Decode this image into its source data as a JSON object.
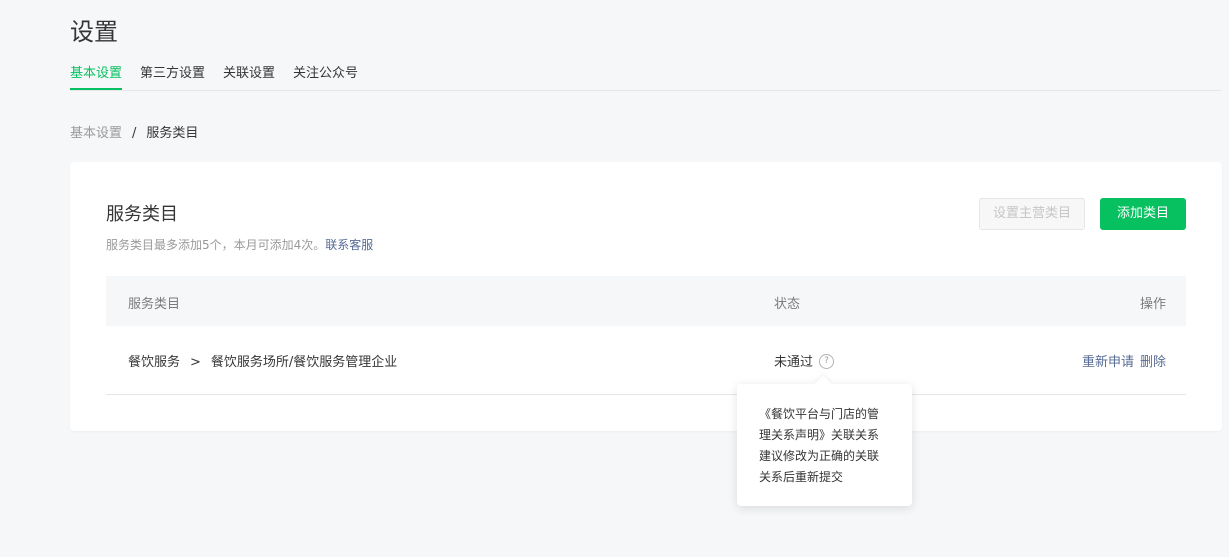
{
  "page": {
    "title": "设置"
  },
  "tabs": [
    {
      "label": "基本设置",
      "active": true
    },
    {
      "label": "第三方设置",
      "active": false
    },
    {
      "label": "关联设置",
      "active": false
    },
    {
      "label": "关注公众号",
      "active": false
    }
  ],
  "breadcrumb": {
    "parent": "基本设置",
    "separator": "/",
    "current": "服务类目"
  },
  "card": {
    "title": "服务类目",
    "desc": "服务类目最多添加5个，本月可添加4次。",
    "desc_link": "联系客服",
    "set_main_button": "设置主营类目",
    "add_button": "添加类目"
  },
  "table": {
    "headers": {
      "category": "服务类目",
      "status": "状态",
      "actions": "操作"
    },
    "rows": [
      {
        "primary": "餐饮服务",
        "arrow": ">",
        "secondary": "餐饮服务场所/餐饮服务管理企业",
        "status": "未通过",
        "help": "?",
        "action_reapply": "重新申请",
        "action_delete": "删除"
      }
    ]
  },
  "tooltip": {
    "lines": [
      "《餐饮平台与门店的管",
      "理关系声明》关联关系",
      "建议修改为正确的关联",
      "关系后重新提交"
    ]
  },
  "colors": {
    "accent": "#07c160",
    "link": "#576b95",
    "background": "#f6f7f9"
  }
}
